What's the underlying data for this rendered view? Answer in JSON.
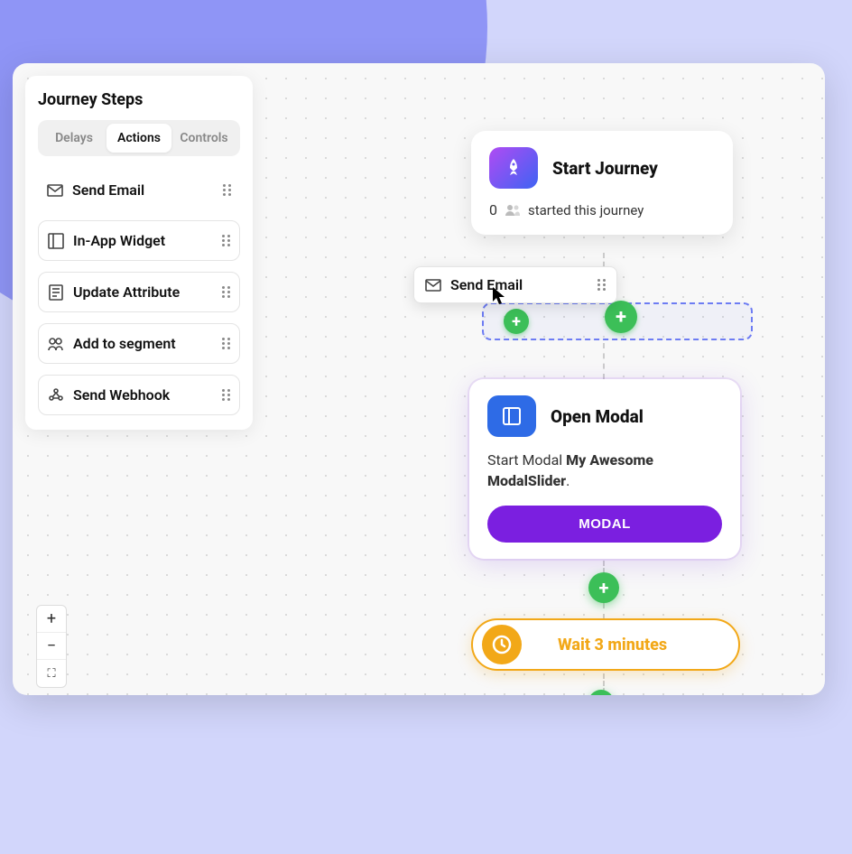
{
  "sidebar": {
    "title": "Journey Steps",
    "tabs": [
      {
        "label": "Delays",
        "active": false
      },
      {
        "label": "Actions",
        "active": true
      },
      {
        "label": "Controls",
        "active": false
      }
    ],
    "steps": [
      {
        "icon": "mail",
        "label": "Send Email"
      },
      {
        "icon": "widget",
        "label": "In-App Widget"
      },
      {
        "icon": "attribute",
        "label": "Update Attribute"
      },
      {
        "icon": "segment",
        "label": "Add to segment"
      },
      {
        "icon": "webhook",
        "label": "Send Webhook"
      }
    ]
  },
  "drag": {
    "icon": "mail",
    "label": "Send Email"
  },
  "nodes": {
    "start": {
      "icon": "rocket",
      "title": "Start Journey",
      "count": "0",
      "subtitle": "started this journey"
    },
    "modal": {
      "icon": "modal",
      "title": "Open Modal",
      "desc_prefix": "Start Modal ",
      "desc_bold": "My Awesome ModalSlider",
      "desc_suffix": ".",
      "button": "MODAL"
    },
    "wait": {
      "label": "Wait 3 minutes"
    }
  },
  "zoom": {
    "in": "+",
    "out": "−",
    "fit": "⛶"
  },
  "colors": {
    "accent_purple": "#7B1FE0",
    "accent_green": "#3CBF58",
    "accent_orange": "#F2A818",
    "accent_blue": "#2E6BE6",
    "bg_lavender": "#8F95F6"
  }
}
